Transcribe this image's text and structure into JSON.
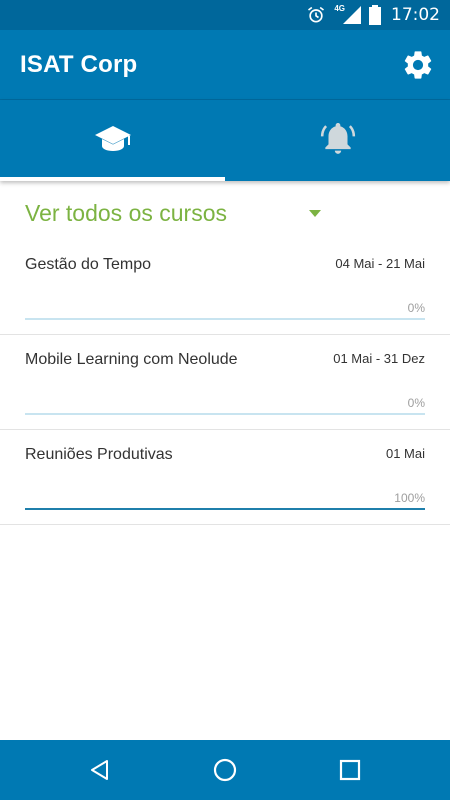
{
  "status_bar": {
    "time": "17:02",
    "network": "4G",
    "icons": [
      "alarm-icon",
      "signal-icon",
      "battery-icon"
    ]
  },
  "app_bar": {
    "title": "ISAT Corp",
    "settings_icon": "gear-icon"
  },
  "tabs": [
    {
      "icon": "graduation-cap-icon",
      "active": true
    },
    {
      "icon": "bell-icon",
      "active": false
    }
  ],
  "filter": {
    "label": "Ver todos os cursos"
  },
  "courses": [
    {
      "name": "Gestão do Tempo",
      "dates": "04 Mai - 21 Mai",
      "progress_label": "0%",
      "progress": 0
    },
    {
      "name": "Mobile Learning com Neolude",
      "dates": "01 Mai - 31 Dez",
      "progress_label": "0%",
      "progress": 0
    },
    {
      "name": "Reuniões Produtivas",
      "dates": "01 Mai",
      "progress_label": "100%",
      "progress": 100
    }
  ],
  "nav_bar": {
    "buttons": [
      "back-icon",
      "home-icon",
      "recents-icon"
    ]
  },
  "colors": {
    "primary": "#0079b3",
    "status_bar": "#00679b",
    "accent_green": "#7cb342",
    "progress_fill": "#1f7fab",
    "progress_track": "#c8e4f0"
  }
}
